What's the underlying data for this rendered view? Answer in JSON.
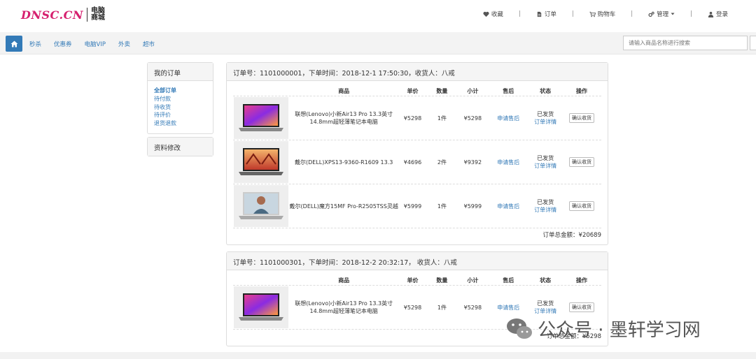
{
  "header": {
    "logo_text": "DNSC.CN",
    "logo_cn": "电脑商城",
    "nav": [
      {
        "label": "收藏",
        "icon": "heart-icon"
      },
      {
        "label": "订单",
        "icon": "file-icon"
      },
      {
        "label": "购物车",
        "icon": "cart-icon"
      },
      {
        "label": "管理",
        "icon": "gears-icon"
      },
      {
        "label": "登录",
        "icon": "user-icon"
      }
    ],
    "separator": "|"
  },
  "navbar": {
    "links": [
      "秒杀",
      "优惠券",
      "电脑VIP",
      "外卖",
      "超市"
    ],
    "search_placeholder": "请输入商品名称进行搜索"
  },
  "sidebar": {
    "my_orders_title": "我的订单",
    "order_links": [
      "全部订单",
      "待付款",
      "待收货",
      "待评价",
      "退货退款"
    ],
    "profile_title": "资料修改"
  },
  "table_headers": [
    "商品",
    "单价",
    "数量",
    "小计",
    "售后",
    "状态",
    "操作"
  ],
  "orders": [
    {
      "header": "订单号：1101000001，下单时间：2018-12-1 17:50:30，收货人：八戒",
      "items": [
        {
          "name": "联想(Lenovo)小新Air13 Pro 13.3英寸14.8mm超轻薄笔记本电脑",
          "price": "¥5298",
          "qty": "1件",
          "subtotal": "¥5298",
          "after_sale": "申请售后",
          "status": "已发货",
          "detail": "订单详情",
          "action": "确认收货"
        },
        {
          "name": "戴尔(DELL)XPS13-9360-R1609 13.3",
          "price": "¥4696",
          "qty": "2件",
          "subtotal": "¥9392",
          "after_sale": "申请售后",
          "status": "已发货",
          "detail": "订单详情",
          "action": "确认收货"
        },
        {
          "name": "戴尔(DELL)魔方15MF Pro-R2505TSS灵越",
          "price": "¥5999",
          "qty": "1件",
          "subtotal": "¥5999",
          "after_sale": "申请售后",
          "status": "已发货",
          "detail": "订单详情",
          "action": "确认收货"
        }
      ],
      "total": "订单总金额：¥20689"
    },
    {
      "header": "订单号：1101000301，下单时间：2018-12-2 20:32:17， 收货人：八戒",
      "items": [
        {
          "name": "联想(Lenovo)小新Air13 Pro 13.3英寸14.8mm超轻薄笔记本电脑",
          "price": "¥5298",
          "qty": "1件",
          "subtotal": "¥5298",
          "after_sale": "申请售后",
          "status": "已发货",
          "detail": "订单详情",
          "action": "确认收货"
        }
      ],
      "total": "订单总金额：¥5298"
    }
  ],
  "watermark": "公众号 · 墨轩学习网",
  "colors": {
    "brand": "#d6206f",
    "link": "#337ab7",
    "panel_bg": "#f5f5f5"
  }
}
